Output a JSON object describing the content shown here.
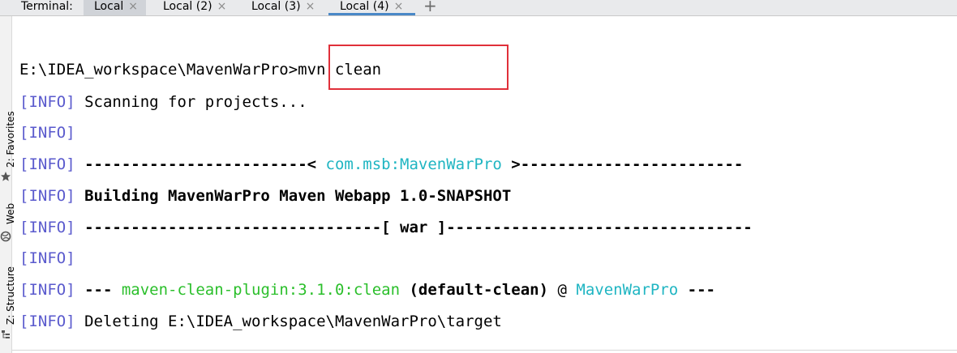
{
  "tabbar": {
    "title": "Terminal:",
    "tabs": [
      {
        "label": "Local",
        "close": "×"
      },
      {
        "label": "Local (2)",
        "close": "×"
      },
      {
        "label": "Local (3)",
        "close": "×"
      },
      {
        "label": "Local (4)",
        "close": "×"
      }
    ],
    "add": "+"
  },
  "sidebar": {
    "items": [
      {
        "label": "2: Favorites",
        "icon": "star-icon"
      },
      {
        "label": "Web",
        "icon": "globe-icon"
      },
      {
        "label": "Z: Structure",
        "icon": "structure-icon"
      }
    ]
  },
  "terminal": {
    "prompt_path": "E:\\IDEA_workspace\\MavenWarPro>",
    "command": "mvn clean",
    "info_tag": "[INFO]",
    "lines": [
      {
        "text": "Scanning for projects..."
      },
      {
        "text": ""
      },
      {
        "left": "------------------------< ",
        "artifact": "com.msb:MavenWarPro",
        "right": " >------------------------"
      },
      {
        "text": "Building MavenWarPro Maven Webapp 1.0-SNAPSHOT"
      },
      {
        "text": "--------------------------------[ war ]---------------------------------"
      },
      {
        "text": ""
      },
      {
        "prefix": "--- ",
        "plugin": "maven-clean-plugin:3.1.0:clean",
        "goal": " (default-clean)",
        "at": " @ ",
        "project": "MavenWarPro",
        "suffix": " ---"
      },
      {
        "text": "Deleting E:\\IDEA_workspace\\MavenWarPro\\target"
      }
    ]
  },
  "colors": {
    "info": "#5a5acd",
    "artifact": "#1fb5c2",
    "plugin": "#2bbf2b",
    "highlight": "#e0303a",
    "tab_active_underline": "#4a88c7"
  }
}
